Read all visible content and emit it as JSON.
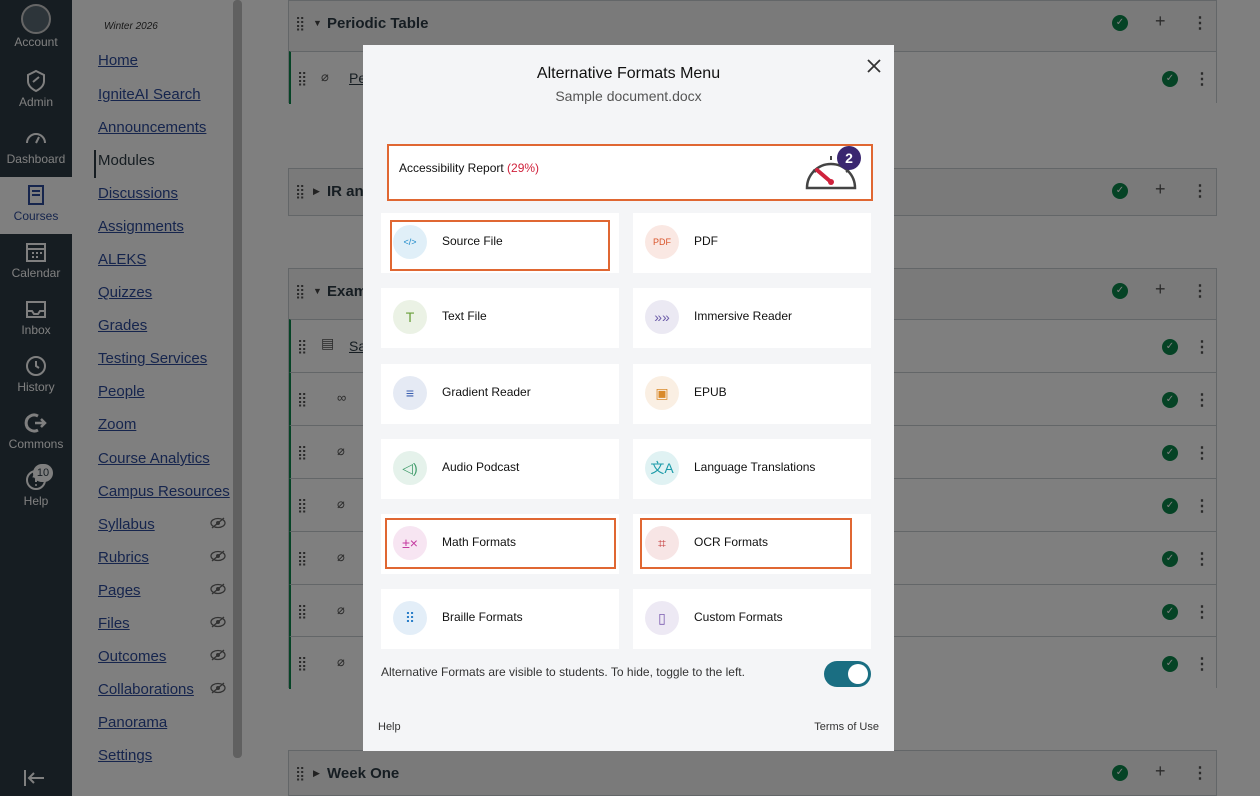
{
  "global_nav": {
    "items": [
      {
        "label": "Account",
        "icon": "account-avatar"
      },
      {
        "label": "Admin",
        "icon": "admin-shield-icon"
      },
      {
        "label": "Dashboard",
        "icon": "dashboard-icon"
      },
      {
        "label": "Courses",
        "icon": "courses-book-icon"
      },
      {
        "label": "Calendar",
        "icon": "calendar-icon"
      },
      {
        "label": "Inbox",
        "icon": "inbox-icon"
      },
      {
        "label": "History",
        "icon": "history-clock-icon"
      },
      {
        "label": "Commons",
        "icon": "commons-icon"
      },
      {
        "label": "Help",
        "icon": "help-icon"
      }
    ],
    "help_badge": "10",
    "collapse_icon": "collapse-arrow-icon"
  },
  "course_nav": {
    "term": "Winter 2026",
    "links": [
      "Home",
      "IgniteAI Search",
      "Announcements",
      "Modules",
      "Discussions",
      "Assignments",
      "ALEKS",
      "Quizzes",
      "Grades",
      "Testing Services",
      "People",
      "Zoom",
      "Course Analytics",
      "Campus Resources",
      "Syllabus",
      "Rubrics",
      "Pages",
      "Files",
      "Outcomes",
      "Collaborations",
      "Panorama",
      "Settings"
    ],
    "active": "Modules"
  },
  "modules": {
    "m1": {
      "title": "Periodic Table",
      "item_text": "Pe"
    },
    "m2": {
      "title": "IR and"
    },
    "m3": {
      "title": "Exam",
      "item_text": "Sa"
    },
    "m4": {
      "title": "Week One"
    }
  },
  "modal": {
    "title": "Alternative Formats Menu",
    "subtitle": "Sample document.docx",
    "close_label": "×",
    "report": {
      "label": "Accessibility Report",
      "percent": "(29%)",
      "badge": "2"
    },
    "formats": [
      {
        "label": "Source File",
        "icon": "source-file-icon",
        "glyph": "</>",
        "color": "#1a88c9"
      },
      {
        "label": "PDF",
        "icon": "pdf-icon",
        "glyph": "PDF",
        "color": "#d9552b"
      },
      {
        "label": "Text File",
        "icon": "text-file-icon",
        "glyph": "T",
        "color": "#6a9f3a"
      },
      {
        "label": "Immersive Reader",
        "icon": "immersive-reader-icon",
        "glyph": "»»",
        "color": "#6b5ba8"
      },
      {
        "label": "Gradient Reader",
        "icon": "gradient-reader-icon",
        "glyph": "≡",
        "color": "#3a5fb0"
      },
      {
        "label": "EPUB",
        "icon": "epub-icon",
        "glyph": "▣",
        "color": "#d98a2b"
      },
      {
        "label": "Audio Podcast",
        "icon": "audio-podcast-icon",
        "glyph": "◁)",
        "color": "#3f9b6a"
      },
      {
        "label": "Language Translations",
        "icon": "language-translations-icon",
        "glyph": "文A",
        "color": "#1a9aa8"
      },
      {
        "label": "Math Formats",
        "icon": "math-formats-icon",
        "glyph": "±×",
        "color": "#c43aa0"
      },
      {
        "label": "OCR Formats",
        "icon": "ocr-formats-icon",
        "glyph": "⌗",
        "color": "#c43a3a"
      },
      {
        "label": "Braille Formats",
        "icon": "braille-formats-icon",
        "glyph": "⠿",
        "color": "#2b7fc9"
      },
      {
        "label": "Custom Formats",
        "icon": "custom-formats-icon",
        "glyph": "▯",
        "color": "#7a5bb0"
      }
    ],
    "toggle_text": "Alternative Formats are visible to students. To hide, toggle to the left.",
    "toggle_on": true,
    "footer_help": "Help",
    "footer_terms": "Terms of Use"
  }
}
